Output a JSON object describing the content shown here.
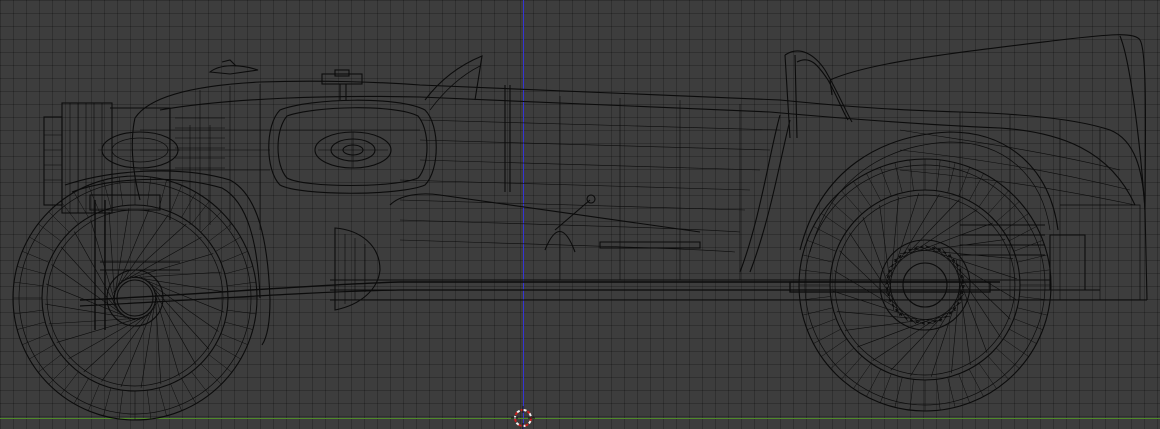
{
  "viewport": {
    "view": "orthographic-side",
    "display_mode": "wireframe",
    "background_color": "#3d3d3d",
    "grid_color": "#2e2e2e",
    "wire_color": "#0b0b0b",
    "axis_colors": {
      "z": "#3434d6",
      "x": "#4f8a2a"
    },
    "cursor_icon": "3d-cursor-icon",
    "model": "vintage-racing-car"
  }
}
